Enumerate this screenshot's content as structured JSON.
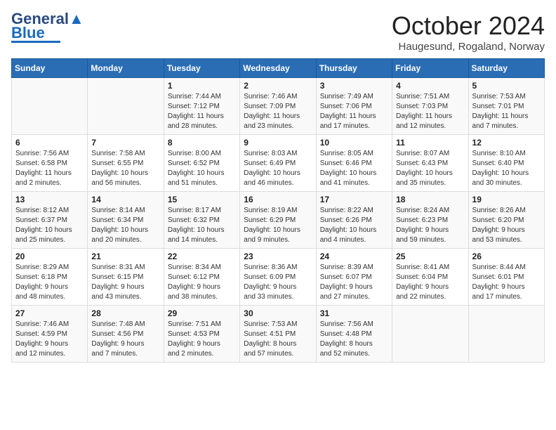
{
  "header": {
    "logo_general": "General",
    "logo_blue": "Blue",
    "month_title": "October 2024",
    "location": "Haugesund, Rogaland, Norway"
  },
  "days_of_week": [
    "Sunday",
    "Monday",
    "Tuesday",
    "Wednesday",
    "Thursday",
    "Friday",
    "Saturday"
  ],
  "weeks": [
    [
      {
        "day": "",
        "info": ""
      },
      {
        "day": "",
        "info": ""
      },
      {
        "day": "1",
        "info": "Sunrise: 7:44 AM\nSunset: 7:12 PM\nDaylight: 11 hours\nand 28 minutes."
      },
      {
        "day": "2",
        "info": "Sunrise: 7:46 AM\nSunset: 7:09 PM\nDaylight: 11 hours\nand 23 minutes."
      },
      {
        "day": "3",
        "info": "Sunrise: 7:49 AM\nSunset: 7:06 PM\nDaylight: 11 hours\nand 17 minutes."
      },
      {
        "day": "4",
        "info": "Sunrise: 7:51 AM\nSunset: 7:03 PM\nDaylight: 11 hours\nand 12 minutes."
      },
      {
        "day": "5",
        "info": "Sunrise: 7:53 AM\nSunset: 7:01 PM\nDaylight: 11 hours\nand 7 minutes."
      }
    ],
    [
      {
        "day": "6",
        "info": "Sunrise: 7:56 AM\nSunset: 6:58 PM\nDaylight: 11 hours\nand 2 minutes."
      },
      {
        "day": "7",
        "info": "Sunrise: 7:58 AM\nSunset: 6:55 PM\nDaylight: 10 hours\nand 56 minutes."
      },
      {
        "day": "8",
        "info": "Sunrise: 8:00 AM\nSunset: 6:52 PM\nDaylight: 10 hours\nand 51 minutes."
      },
      {
        "day": "9",
        "info": "Sunrise: 8:03 AM\nSunset: 6:49 PM\nDaylight: 10 hours\nand 46 minutes."
      },
      {
        "day": "10",
        "info": "Sunrise: 8:05 AM\nSunset: 6:46 PM\nDaylight: 10 hours\nand 41 minutes."
      },
      {
        "day": "11",
        "info": "Sunrise: 8:07 AM\nSunset: 6:43 PM\nDaylight: 10 hours\nand 35 minutes."
      },
      {
        "day": "12",
        "info": "Sunrise: 8:10 AM\nSunset: 6:40 PM\nDaylight: 10 hours\nand 30 minutes."
      }
    ],
    [
      {
        "day": "13",
        "info": "Sunrise: 8:12 AM\nSunset: 6:37 PM\nDaylight: 10 hours\nand 25 minutes."
      },
      {
        "day": "14",
        "info": "Sunrise: 8:14 AM\nSunset: 6:34 PM\nDaylight: 10 hours\nand 20 minutes."
      },
      {
        "day": "15",
        "info": "Sunrise: 8:17 AM\nSunset: 6:32 PM\nDaylight: 10 hours\nand 14 minutes."
      },
      {
        "day": "16",
        "info": "Sunrise: 8:19 AM\nSunset: 6:29 PM\nDaylight: 10 hours\nand 9 minutes."
      },
      {
        "day": "17",
        "info": "Sunrise: 8:22 AM\nSunset: 6:26 PM\nDaylight: 10 hours\nand 4 minutes."
      },
      {
        "day": "18",
        "info": "Sunrise: 8:24 AM\nSunset: 6:23 PM\nDaylight: 9 hours\nand 59 minutes."
      },
      {
        "day": "19",
        "info": "Sunrise: 8:26 AM\nSunset: 6:20 PM\nDaylight: 9 hours\nand 53 minutes."
      }
    ],
    [
      {
        "day": "20",
        "info": "Sunrise: 8:29 AM\nSunset: 6:18 PM\nDaylight: 9 hours\nand 48 minutes."
      },
      {
        "day": "21",
        "info": "Sunrise: 8:31 AM\nSunset: 6:15 PM\nDaylight: 9 hours\nand 43 minutes."
      },
      {
        "day": "22",
        "info": "Sunrise: 8:34 AM\nSunset: 6:12 PM\nDaylight: 9 hours\nand 38 minutes."
      },
      {
        "day": "23",
        "info": "Sunrise: 8:36 AM\nSunset: 6:09 PM\nDaylight: 9 hours\nand 33 minutes."
      },
      {
        "day": "24",
        "info": "Sunrise: 8:39 AM\nSunset: 6:07 PM\nDaylight: 9 hours\nand 27 minutes."
      },
      {
        "day": "25",
        "info": "Sunrise: 8:41 AM\nSunset: 6:04 PM\nDaylight: 9 hours\nand 22 minutes."
      },
      {
        "day": "26",
        "info": "Sunrise: 8:44 AM\nSunset: 6:01 PM\nDaylight: 9 hours\nand 17 minutes."
      }
    ],
    [
      {
        "day": "27",
        "info": "Sunrise: 7:46 AM\nSunset: 4:59 PM\nDaylight: 9 hours\nand 12 minutes."
      },
      {
        "day": "28",
        "info": "Sunrise: 7:48 AM\nSunset: 4:56 PM\nDaylight: 9 hours\nand 7 minutes."
      },
      {
        "day": "29",
        "info": "Sunrise: 7:51 AM\nSunset: 4:53 PM\nDaylight: 9 hours\nand 2 minutes."
      },
      {
        "day": "30",
        "info": "Sunrise: 7:53 AM\nSunset: 4:51 PM\nDaylight: 8 hours\nand 57 minutes."
      },
      {
        "day": "31",
        "info": "Sunrise: 7:56 AM\nSunset: 4:48 PM\nDaylight: 8 hours\nand 52 minutes."
      },
      {
        "day": "",
        "info": ""
      },
      {
        "day": "",
        "info": ""
      }
    ]
  ]
}
